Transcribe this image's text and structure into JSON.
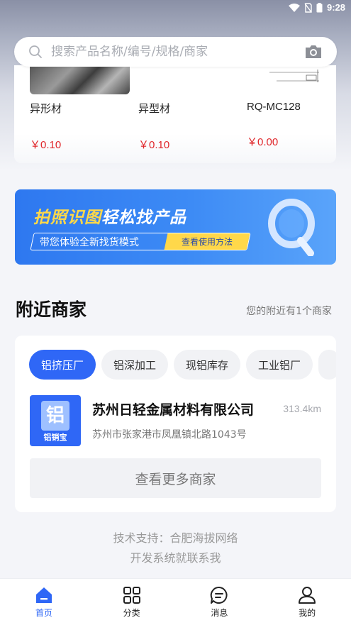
{
  "status_bar": {
    "time": "9:28"
  },
  "search": {
    "placeholder": "搜索产品名称/编号/规格/商家"
  },
  "products": [
    {
      "name": "异形材",
      "price": "￥0.10"
    },
    {
      "name": "异型材",
      "price": "￥0.10"
    },
    {
      "name": "RQ-MC128",
      "price": "￥0.00"
    }
  ],
  "banner": {
    "title_a": "拍照识图",
    "title_b": "轻松找产品",
    "subtitle": "带您体验全新找货模式",
    "link": "查看使用方法"
  },
  "nearby": {
    "title": "附近商家",
    "note": "您的附近有1个商家",
    "chips": [
      "铝挤压厂",
      "铝深加工",
      "现铝库存",
      "工业铝厂"
    ],
    "merchant": {
      "logo_glyph": "铝",
      "logo_text": "铝销宝",
      "name": "苏州日轻金属材料有限公司",
      "distance": "313.4km",
      "address": "苏州市张家港市凤凰镇北路1043号"
    },
    "more_button": "查看更多商家"
  },
  "footer": {
    "line1": "技术支持：合肥海拔网络",
    "line2": "开发系统就联系我"
  },
  "tabbar": [
    {
      "label": "首页",
      "icon": "home-icon"
    },
    {
      "label": "分类",
      "icon": "grid-icon"
    },
    {
      "label": "消息",
      "icon": "message-icon"
    },
    {
      "label": "我的",
      "icon": "user-icon"
    }
  ],
  "colors": {
    "accent": "#2f67f6",
    "price": "#e0262a",
    "banner_highlight": "#ffd84a"
  }
}
